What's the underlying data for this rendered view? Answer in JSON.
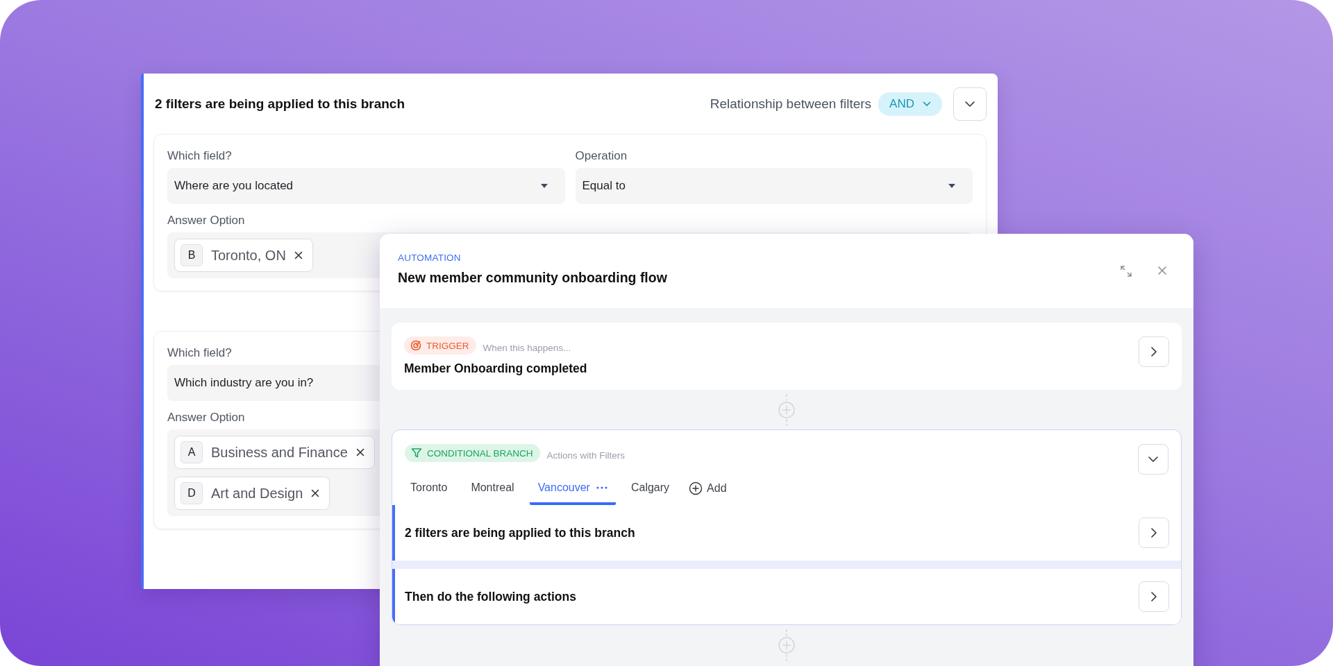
{
  "filter_panel": {
    "title": "2 filters are being applied to this branch",
    "relationship_label": "Relationship between filters",
    "relationship": "AND",
    "filters": [
      {
        "field_label": "Which field?",
        "field": "Where are you located",
        "operation_label": "Operation",
        "operation": "Equal to",
        "answer_label": "Answer Option",
        "answers": [
          {
            "letter": "B",
            "text": "Toronto, ON"
          }
        ]
      },
      {
        "field_label": "Which field?",
        "field": "Which industry are you in?",
        "answer_label": "Answer Option",
        "answers": [
          {
            "letter": "A",
            "text": "Business and Finance"
          },
          {
            "letter": "D",
            "text": "Art and Design"
          }
        ]
      }
    ]
  },
  "automation": {
    "eyebrow": "AUTOMATION",
    "title": "New member community onboarding flow",
    "steps": [
      {
        "kind": "trigger",
        "badge": "TRIGGER",
        "hint": "When this happens...",
        "title": "Member Onboarding completed"
      },
      {
        "kind": "branch",
        "badge": "CONDITIONAL BRANCH",
        "hint": "Actions with Filters",
        "tabs": [
          {
            "label": "Toronto",
            "selected": false
          },
          {
            "label": "Montreal",
            "selected": false
          },
          {
            "label": "Vancouver",
            "selected": true
          },
          {
            "label": "Calgary",
            "selected": false
          }
        ],
        "add_label": "Add",
        "rows": [
          "2 filters are being applied to this branch",
          "Then do the following actions"
        ]
      }
    ]
  }
}
